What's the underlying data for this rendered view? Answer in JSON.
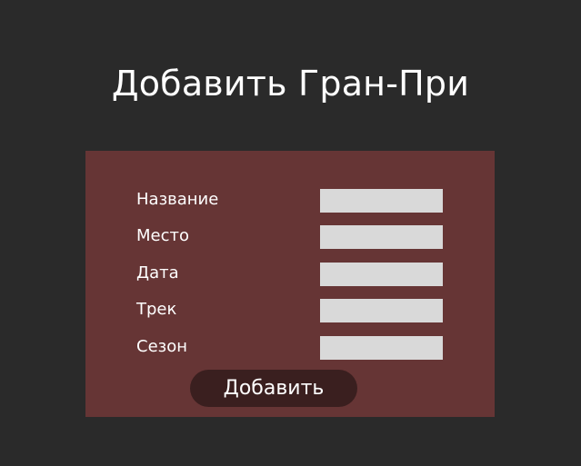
{
  "page": {
    "title": "Добавить Гран-При"
  },
  "form": {
    "fields": [
      {
        "label": "Название",
        "value": ""
      },
      {
        "label": "Место",
        "value": ""
      },
      {
        "label": "Дата",
        "value": ""
      },
      {
        "label": "Трек",
        "value": ""
      },
      {
        "label": "Сезон",
        "value": ""
      }
    ],
    "submit_label": "Добавить"
  },
  "colors": {
    "background": "#2a2a2a",
    "panel": "#663535",
    "input": "#d9d9d9",
    "button": "#3a1f1f",
    "text": "#ffffff"
  }
}
